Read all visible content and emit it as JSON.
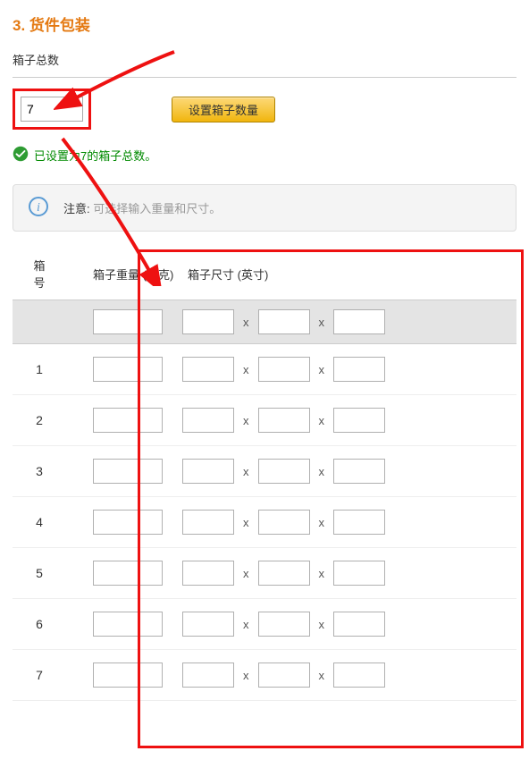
{
  "section": {
    "title": "3. 货件包装",
    "boxTotalLabel": "箱子总数",
    "boxTotalValue": "7",
    "setButtonLabel": "设置箱子数量"
  },
  "success": {
    "message": "已设置为7的箱子总数。"
  },
  "info": {
    "noteLabel": "注意:",
    "noteText": "可选择输入重量和尺寸。"
  },
  "tableHeaders": {
    "boxNumber": "箱\n号",
    "boxWeight": "箱子重量 (千克)",
    "boxDimensions": "箱子尺寸 (英寸)",
    "x": "x"
  },
  "rows": [
    {
      "num": "",
      "weight": "",
      "d1": "",
      "d2": "",
      "d3": ""
    },
    {
      "num": "1",
      "weight": "",
      "d1": "",
      "d2": "",
      "d3": ""
    },
    {
      "num": "2",
      "weight": "",
      "d1": "",
      "d2": "",
      "d3": ""
    },
    {
      "num": "3",
      "weight": "",
      "d1": "",
      "d2": "",
      "d3": ""
    },
    {
      "num": "4",
      "weight": "",
      "d1": "",
      "d2": "",
      "d3": ""
    },
    {
      "num": "5",
      "weight": "",
      "d1": "",
      "d2": "",
      "d3": ""
    },
    {
      "num": "6",
      "weight": "",
      "d1": "",
      "d2": "",
      "d3": ""
    },
    {
      "num": "7",
      "weight": "",
      "d1": "",
      "d2": "",
      "d3": ""
    }
  ],
  "colors": {
    "accent": "#e47911",
    "annotation": "#e11"
  }
}
